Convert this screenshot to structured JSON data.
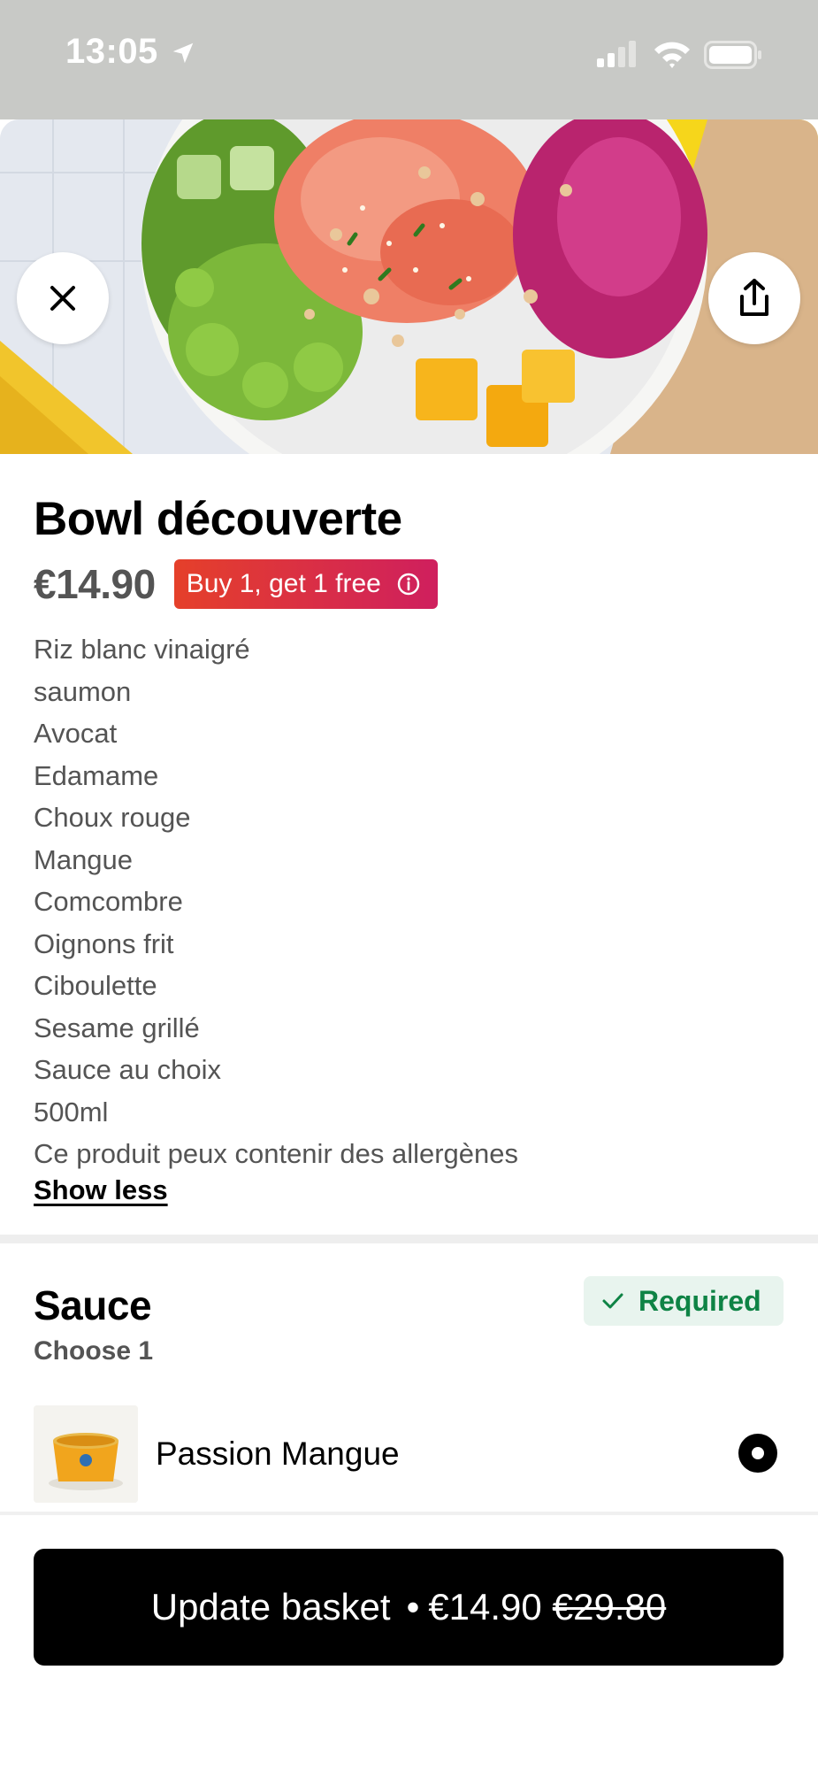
{
  "status_bar": {
    "time": "13:05",
    "icons": [
      "location-arrow-icon",
      "cellular-signal-icon",
      "wifi-icon",
      "battery-icon"
    ]
  },
  "hero": {
    "image": "poke-bowl-photo",
    "close_icon": "close-icon",
    "share_icon": "share-icon"
  },
  "item": {
    "title": "Bowl découverte",
    "price": "€14.90",
    "promo": "Buy 1, get 1 free",
    "promo_icon": "info-icon",
    "promo_colors": [
      "#e5402a",
      "#cf1f5e"
    ],
    "description": [
      "Riz blanc vinaigré",
      "saumon",
      "Avocat",
      "Edamame",
      "Choux rouge",
      "Mangue",
      "Comcombre",
      "Oignons frit",
      "Ciboulette",
      "Sesame grillé",
      "Sauce au choix",
      "500ml",
      "Ce produit peux contenir des allergènes"
    ],
    "show_less": "Show less"
  },
  "sauce": {
    "title": "Sauce",
    "subtitle": "Choose 1",
    "required": "Required",
    "required_color": "#0e8345",
    "options": [
      {
        "label": "Passion Mangue",
        "selected": true
      }
    ]
  },
  "cta": {
    "label": "Update basket",
    "separator": "•",
    "price": "€14.90",
    "old_price": "€29.80"
  }
}
